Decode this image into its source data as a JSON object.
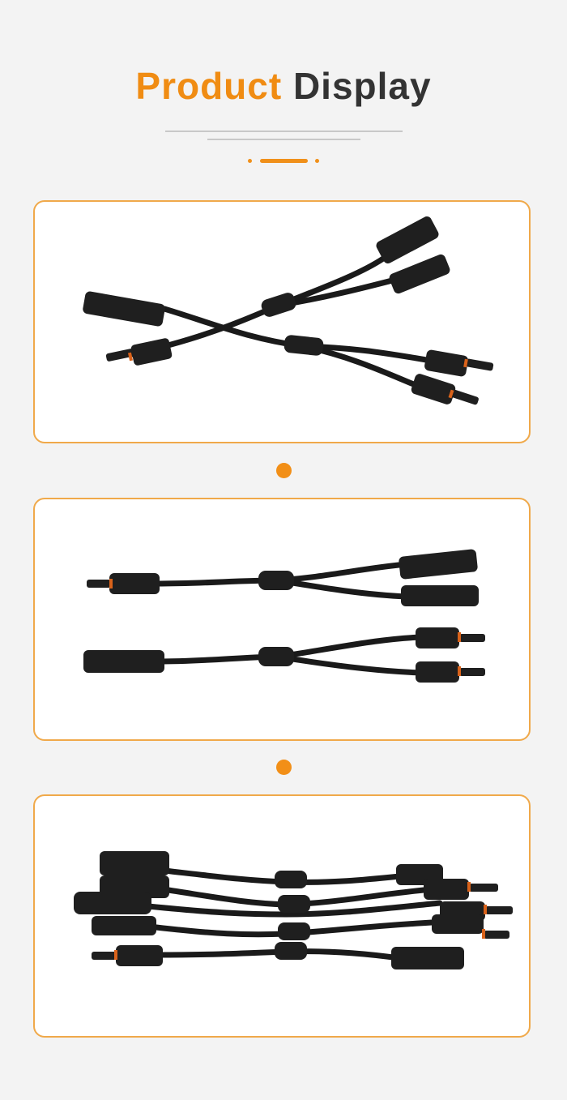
{
  "header": {
    "title_word1": "Product",
    "title_word2": "Display"
  },
  "colors": {
    "accent": "#f08c13",
    "title_dark": "#333333",
    "panel_border": "#f0a94a",
    "background": "#f3f3f3"
  },
  "gallery": {
    "images": [
      {
        "subject": "cable-connectors-crossed"
      },
      {
        "subject": "cable-connectors-parallel"
      },
      {
        "subject": "cable-connectors-bundle"
      }
    ]
  }
}
